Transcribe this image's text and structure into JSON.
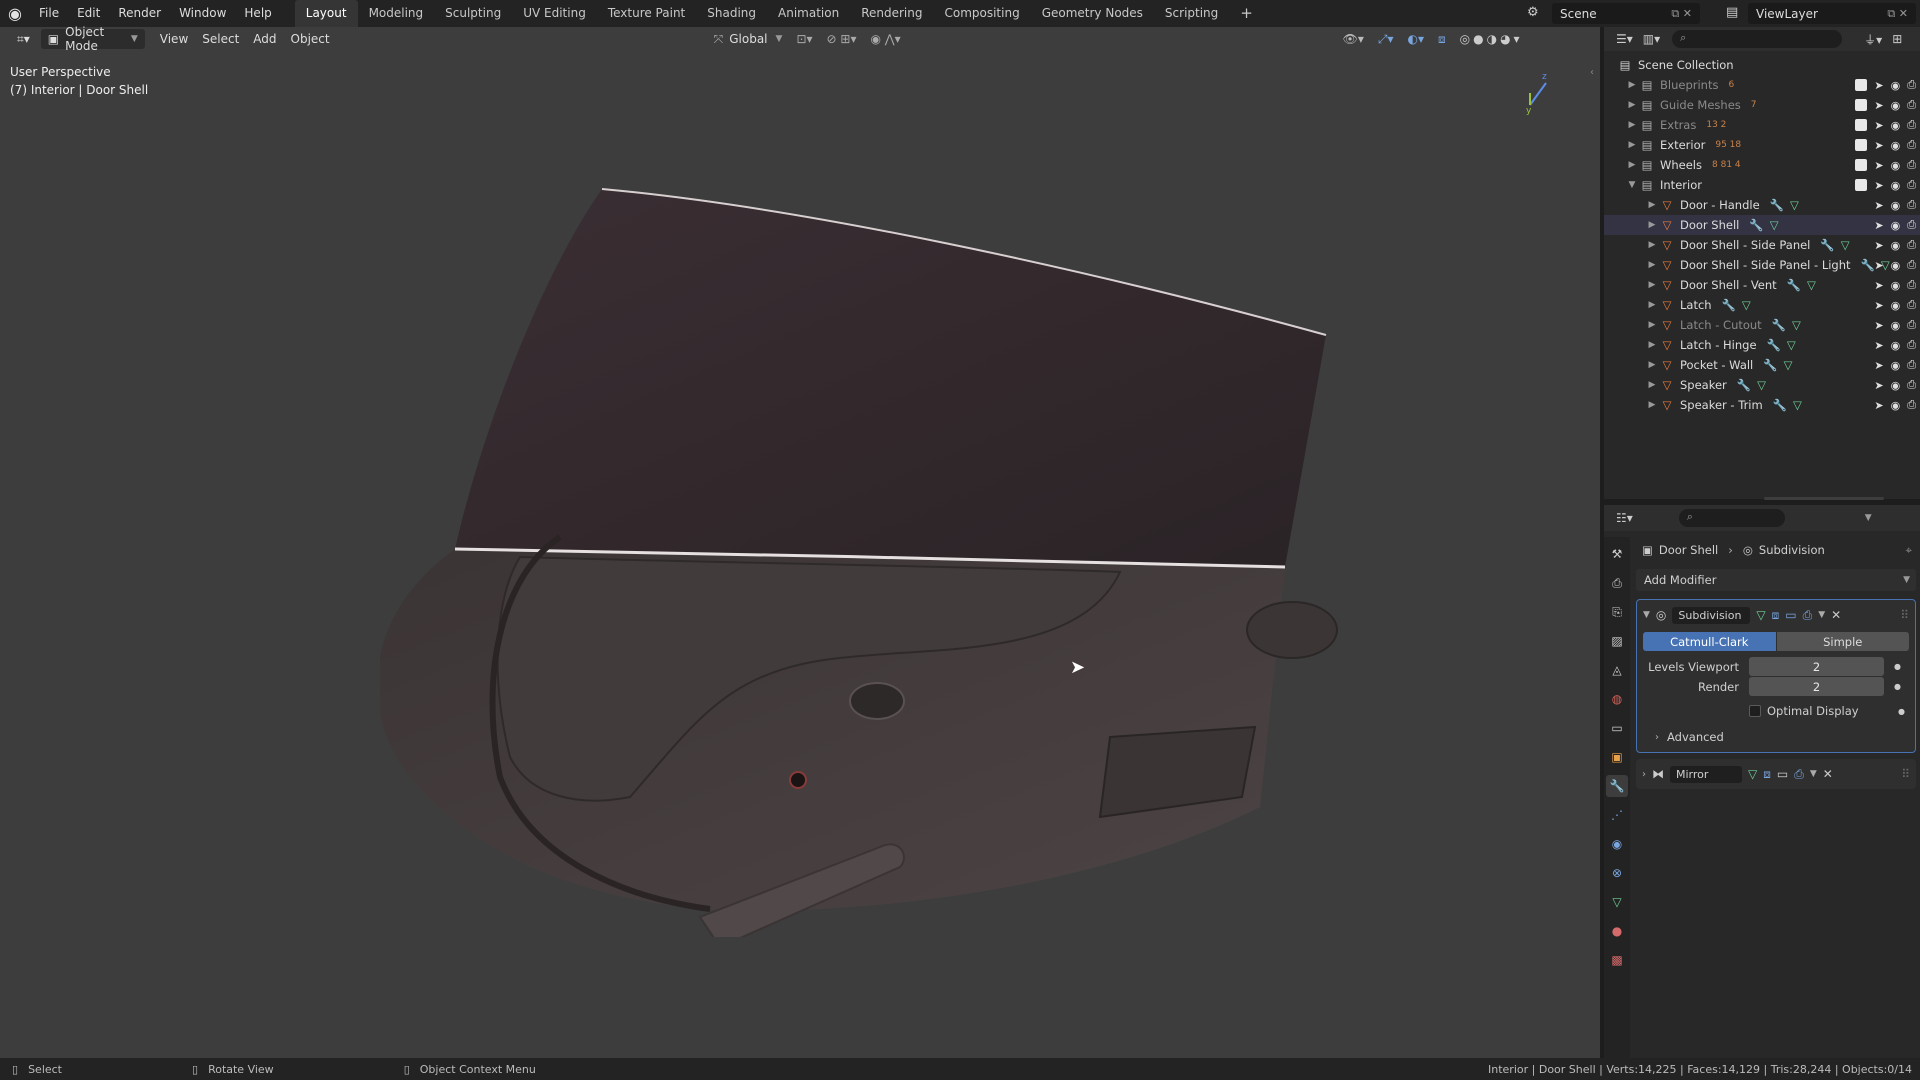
{
  "topbar": {
    "menus": [
      "File",
      "Edit",
      "Render",
      "Window",
      "Help"
    ],
    "workspaces": [
      "Layout",
      "Modeling",
      "Sculpting",
      "UV Editing",
      "Texture Paint",
      "Shading",
      "Animation",
      "Rendering",
      "Compositing",
      "Geometry Nodes",
      "Scripting"
    ],
    "active_workspace": "Layout",
    "add_tab": "+",
    "scene_name": "Scene",
    "view_layer": "ViewLayer"
  },
  "viewport": {
    "mode": "Object Mode",
    "menus": [
      "View",
      "Select",
      "Add",
      "Object"
    ],
    "transform_orientation": "Global",
    "info_line1": "User Perspective",
    "info_line2": "(7) Interior | Door Shell"
  },
  "outliner": {
    "root": "Scene Collection",
    "collections": [
      {
        "name": "Blueprints",
        "count": "6",
        "dim": true
      },
      {
        "name": "Guide Meshes",
        "count": "7",
        "dim": true
      },
      {
        "name": "Extras",
        "count": "13 2",
        "dim": true
      },
      {
        "name": "Exterior",
        "count": "95 18",
        "dim": false
      },
      {
        "name": "Wheels",
        "count": "8 81 4",
        "dim": false
      },
      {
        "name": "Interior",
        "count": "",
        "dim": false
      }
    ],
    "objects": [
      {
        "name": "Door - Handle",
        "dim": false
      },
      {
        "name": "Door Shell",
        "dim": false
      },
      {
        "name": "Door Shell - Side Panel",
        "dim": false
      },
      {
        "name": "Door Shell - Side Panel - Light",
        "dim": false
      },
      {
        "name": "Door Shell - Vent",
        "dim": false
      },
      {
        "name": "Latch",
        "dim": false
      },
      {
        "name": "Latch - Cutout",
        "dim": true
      },
      {
        "name": "Latch - Hinge",
        "dim": false
      },
      {
        "name": "Pocket - Wall",
        "dim": false
      },
      {
        "name": "Speaker",
        "dim": false
      },
      {
        "name": "Speaker - Trim",
        "dim": false
      }
    ]
  },
  "properties": {
    "breadcrumb_object": "Door Shell",
    "breadcrumb_modifier": "Subdivision",
    "add_modifier": "Add Modifier",
    "subdivision": {
      "name": "Subdivision",
      "option_a": "Catmull-Clark",
      "option_b": "Simple",
      "levels_viewport_label": "Levels Viewport",
      "levels_viewport": "2",
      "render_label": "Render",
      "render": "2",
      "optimal_display": "Optimal Display",
      "advanced": "Advanced"
    },
    "mirror": {
      "name": "Mirror"
    }
  },
  "statusbar": {
    "select": "Select",
    "rotate": "Rotate View",
    "context": "Object Context Menu",
    "stats": "Interior | Door Shell | Verts:14,225 | Faces:14,129 | Tris:28,244 | Objects:0/14"
  },
  "colors": {
    "accent_blue": "#4772b3",
    "mesh_orange": "#e87d3e",
    "modifier_green": "#6fcf97",
    "wrench_blue": "#7aa6e0"
  }
}
